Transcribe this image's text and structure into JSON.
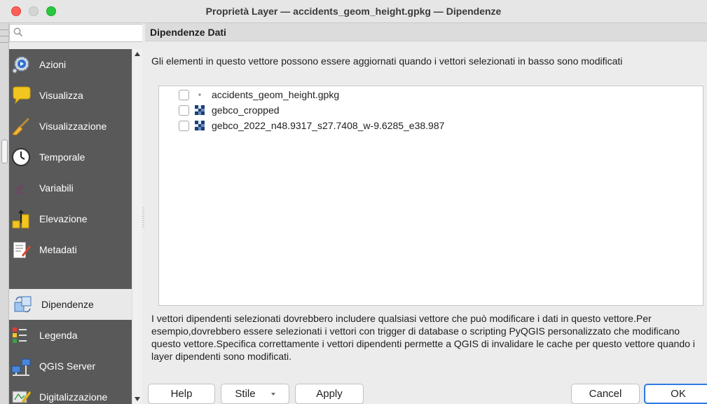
{
  "window": {
    "title": "Proprietà Layer — accidents_geom_height.gpkg — Dipendenze"
  },
  "search": {
    "placeholder": "",
    "value": ""
  },
  "sidebar": {
    "items": [
      {
        "label": "Azioni",
        "icon": "gear-play-icon"
      },
      {
        "label": "Visualizza",
        "icon": "speech-bubble-icon"
      },
      {
        "label": "Visualizzazione",
        "icon": "paintbrush-icon"
      },
      {
        "label": "Temporale",
        "icon": "clock-icon"
      },
      {
        "label": "Variabili",
        "icon": "epsilon-icon"
      },
      {
        "label": "Elevazione",
        "icon": "elevation-icon"
      },
      {
        "label": "Metadati",
        "icon": "metadata-icon"
      },
      {
        "label": "Dipendenze",
        "icon": "dependencies-icon",
        "active": true
      },
      {
        "label": "Legenda",
        "icon": "legend-icon"
      },
      {
        "label": "QGIS Server",
        "icon": "server-icon"
      },
      {
        "label": "Digitalizzazione",
        "icon": "digitizing-icon"
      }
    ]
  },
  "main": {
    "section_title": "Dipendenze Dati",
    "intro": "Gli elementi in questo vettore possono essere aggiornati quando i vettori selezionati in basso sono modificati",
    "layers": [
      {
        "name": "accidents_geom_height.gpkg",
        "checked": false,
        "icon": "point-layer-icon"
      },
      {
        "name": "gebco_cropped",
        "checked": false,
        "icon": "raster-layer-icon"
      },
      {
        "name": "gebco_2022_n48.9317_s27.7408_w-9.6285_e38.987",
        "checked": false,
        "icon": "raster-layer-icon"
      }
    ],
    "help_text": "I vettori dipendenti selezionati dovrebbero includere qualsiasi vettore che può modificare i dati in questo vettore.Per esempio,dovrebbero essere selezionati i vettori con trigger di database o scripting PyQGIS personalizzato che modificano questo vettore.Specifica correttamente i vettori dipendenti permette a QGIS di invalidare le cache per questo vettore quando i layer dipendenti sono modificati."
  },
  "buttons": {
    "help": "Help",
    "style": "Stile",
    "apply": "Apply",
    "cancel": "Cancel",
    "ok": "OK"
  },
  "colors": {
    "sidebar_bg": "#595959",
    "accent": "#2f7ae5"
  }
}
